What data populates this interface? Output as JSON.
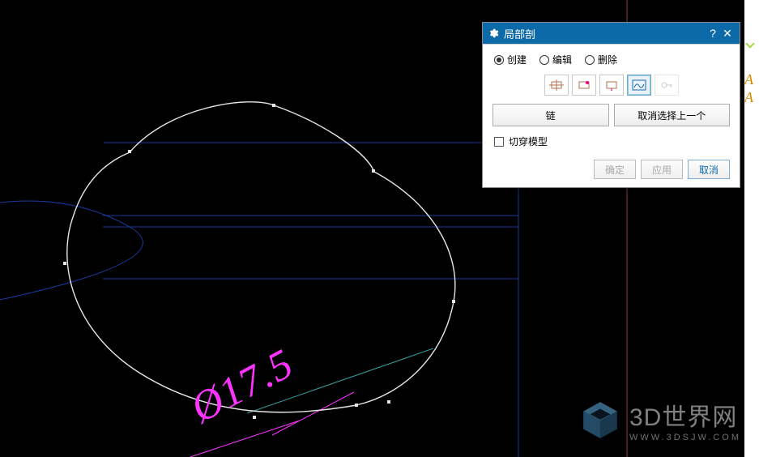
{
  "dialog": {
    "title": "局部剖",
    "radios": {
      "create": "创建",
      "edit": "编辑",
      "delete": "删除"
    },
    "big_buttons": {
      "chain": "链",
      "deselect_last": "取消选择上一个"
    },
    "checkbox": {
      "cut_through_model": "切穿模型"
    },
    "footer": {
      "ok": "确定",
      "apply": "应用",
      "cancel": "取消"
    },
    "help": "?",
    "close": "✕"
  },
  "dimension": {
    "value": "Ø17.5"
  },
  "watermark": {
    "name": "3D世界网",
    "url": "WWW.3DSJW.COM"
  },
  "sidebar": {
    "a1": "A",
    "a2": "A"
  }
}
